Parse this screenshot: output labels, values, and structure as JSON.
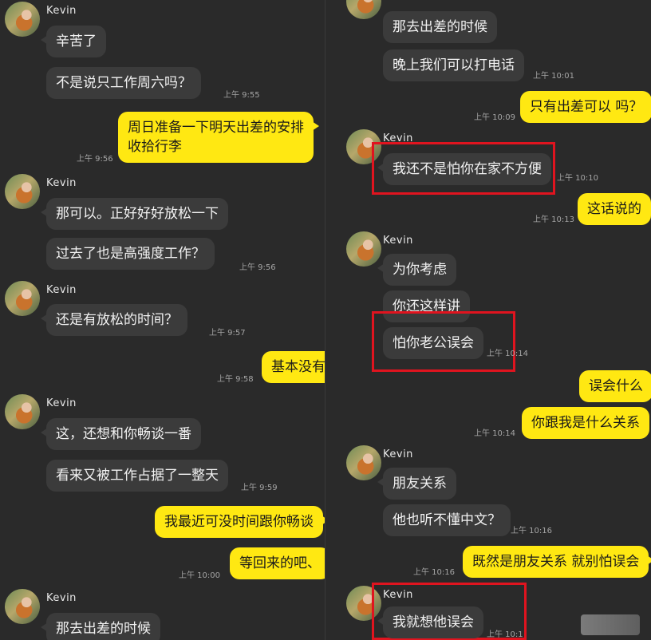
{
  "contact_name": "Kevin",
  "left": {
    "messages": {
      "m1": "辛苦了",
      "m2": "不是说只工作周六吗？",
      "t1": "上午 9:55",
      "m3": "周日准备一下明天出差的安排\n收拾行李",
      "t2": "上午 9:56",
      "m4": "那可以。正好好好放松一下",
      "m5": "过去了也是高强度工作？",
      "t3": "上午 9:56",
      "m6": "还是有放松的时间？",
      "t4": "上午 9:57",
      "m7": "基本没有",
      "t5": "上午 9:58",
      "m8": "这，还想和你畅谈一番",
      "m9": "看来又被工作占据了一整天",
      "t6": "上午 9:59",
      "m10": "我最近可没时间跟你畅谈",
      "m11": "等回来的吧、",
      "t7": "上午 10:00",
      "m12": "那去出差的时候"
    }
  },
  "right": {
    "messages": {
      "r1": "那去出差的时候",
      "r2": "晚上我们可以打电话",
      "rt1": "上午 10:01",
      "r3": "只有出差可以 吗？",
      "rt2": "上午 10:09",
      "r4": "我还不是怕你在家不方便",
      "rt3": "上午 10:10",
      "r5": "这话说的",
      "rt4": "上午 10:13",
      "r6": "为你考虑",
      "r7": "你还这样讲",
      "r8": "怕你老公误会",
      "rt5": "上午 10:14",
      "r9": "误会什么",
      "r10": "你跟我是什么关系",
      "rt6": "上午 10:14",
      "r11": "朋友关系",
      "r12": "他也听不懂中文？",
      "rt7": "上午 10:16",
      "r13": "既然是朋友关系 就别怕误会",
      "rt8": "上午 10:16",
      "r14": "我就想他误会",
      "rt9": "上午 10:1"
    }
  },
  "colors": {
    "incoming": "#3b3b3b",
    "outgoing": "#ffe812",
    "highlight": "#e0141f",
    "background": "#2a2a2a"
  }
}
